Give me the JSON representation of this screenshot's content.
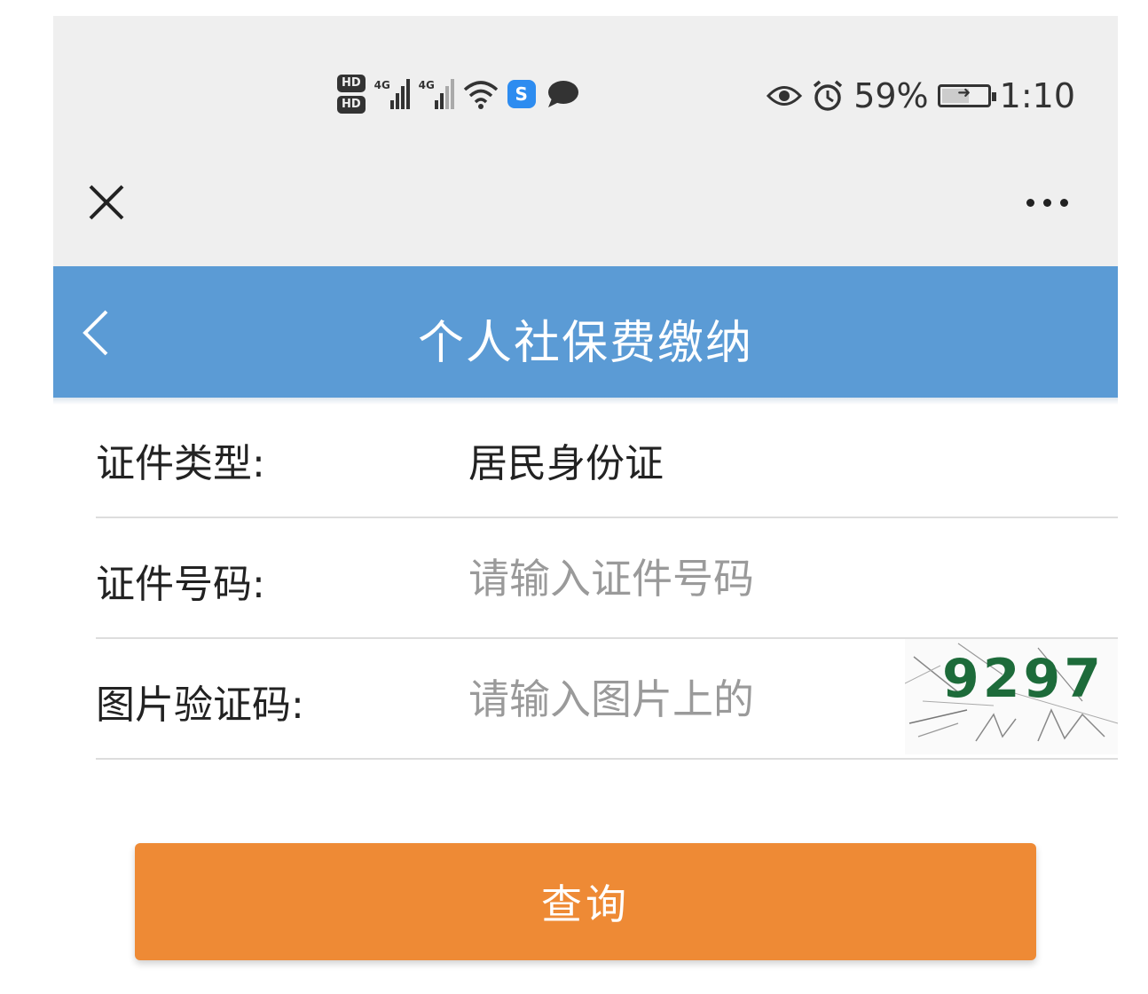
{
  "status_bar": {
    "hd_top": "HD",
    "hd_bottom": "HD",
    "sim1_label": "4G",
    "sim2_label": "4G",
    "app_badge_glyph": "S",
    "battery_percent": "59%",
    "battery_level": 0.59,
    "time": "1:10",
    "icons": [
      "hd-icon",
      "signal-icon",
      "wifi-icon",
      "app-badge-icon",
      "chat-icon",
      "eye-icon",
      "alarm-icon",
      "battery-icon"
    ]
  },
  "wechat_bar": {
    "close_icon": "close-icon",
    "more_icon": "more-icon"
  },
  "header": {
    "title": "个人社保费缴纳",
    "back_icon": "chevron-left-icon",
    "bg_color": "#5b9bd5"
  },
  "form": {
    "id_type": {
      "label": "证件类型:",
      "value": "居民身份证"
    },
    "id_number": {
      "label": "证件号码:",
      "placeholder": "请输入证件号码"
    },
    "captcha": {
      "label": "图片验证码:",
      "placeholder": "请输入图片上的",
      "code": "9297"
    }
  },
  "query_button": {
    "label": "查询",
    "color": "#ee8a35"
  }
}
